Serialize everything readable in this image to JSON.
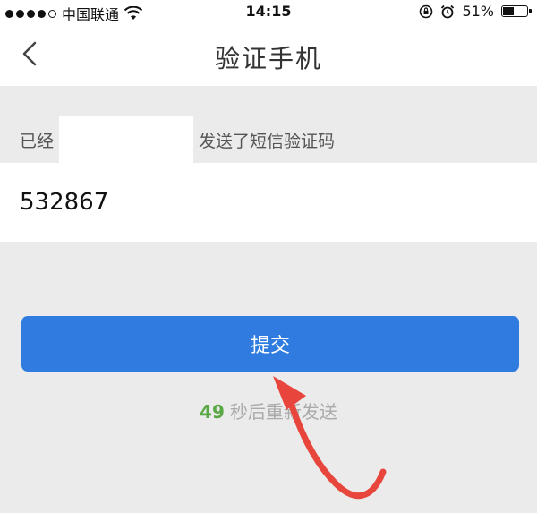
{
  "status_bar": {
    "carrier": "中国联通",
    "time": "14:15",
    "battery": "51%",
    "battery_level": 0.51
  },
  "nav": {
    "title": "验证手机",
    "back_icon": "chevron-left-icon"
  },
  "info": {
    "prefix": "已经",
    "suffix": "发送了短信验证码"
  },
  "code_input": {
    "value": "532867"
  },
  "submit": {
    "label": "提交"
  },
  "resend": {
    "countdown": "49",
    "text": "秒后重新发送"
  },
  "colors": {
    "accent": "#2f7be0",
    "countdown": "#5aa845",
    "annotation_arrow": "#e8453c"
  }
}
